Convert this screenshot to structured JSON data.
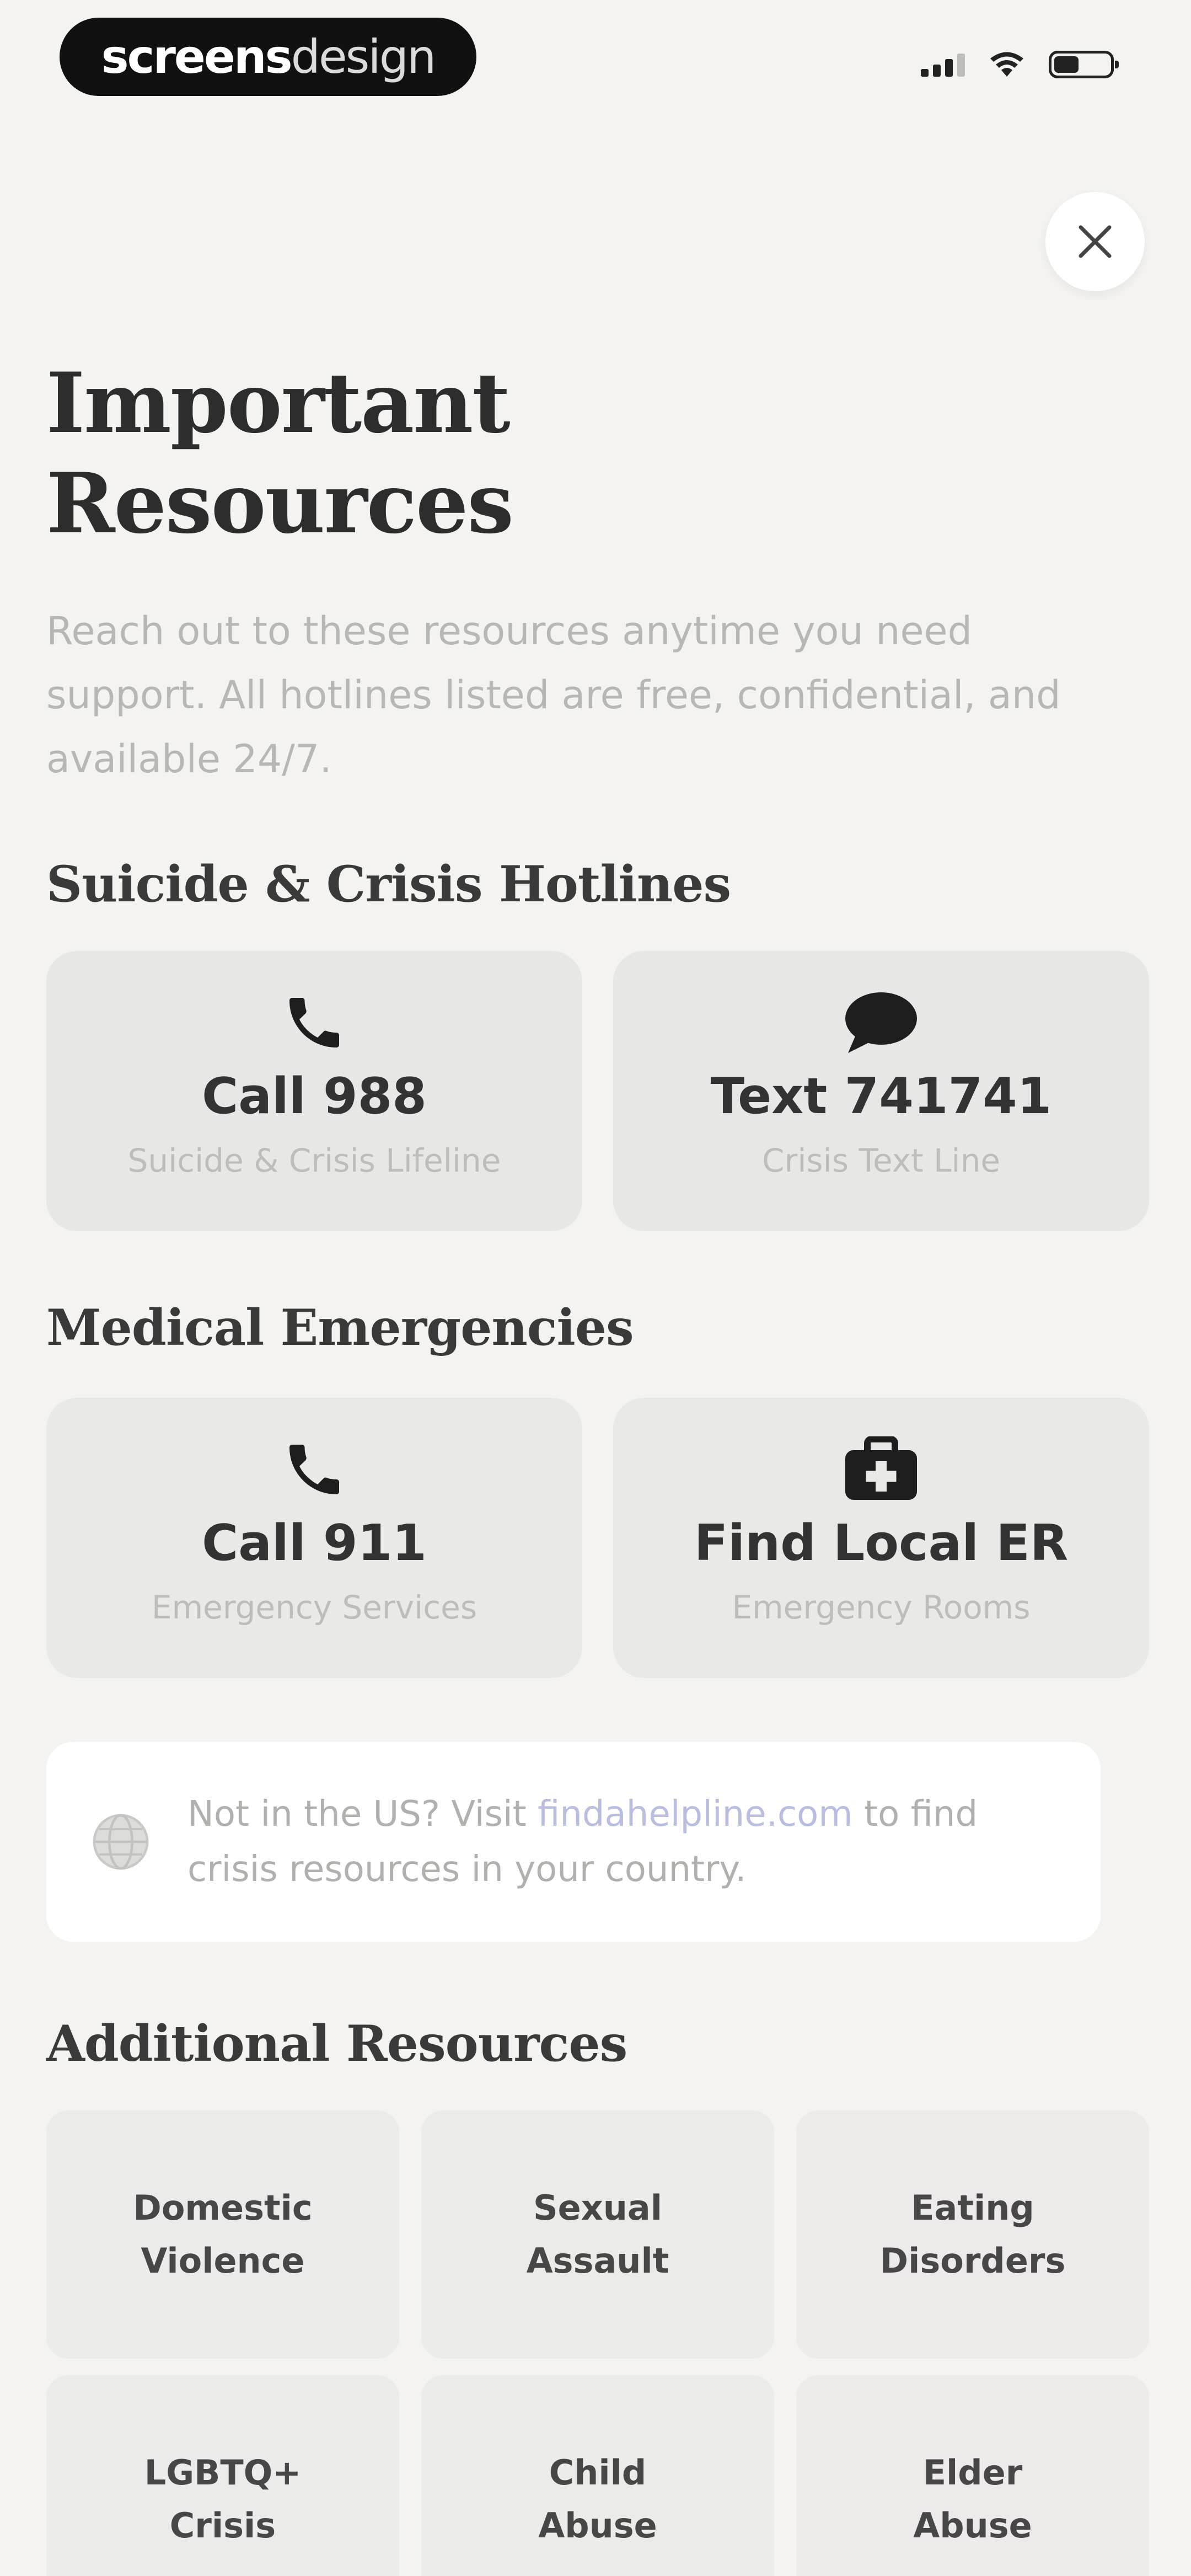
{
  "status_bar": {
    "watermark_bold": "screens",
    "watermark_light": "design"
  },
  "header": {
    "close_label": "Close",
    "title_line1": "Important",
    "title_line2": "Resources",
    "subtitle": "Reach out to these resources anytime you need support. All hotlines listed are free, confidential, and available 24/7."
  },
  "crisis": {
    "heading": "Suicide & Crisis Hotlines",
    "cards": [
      {
        "icon": "phone-icon",
        "title": "Call 988",
        "subtitle": "Suicide & Crisis Lifeline"
      },
      {
        "icon": "chat-bubble-icon",
        "title": "Text 741741",
        "subtitle": "Crisis Text Line"
      }
    ]
  },
  "medical": {
    "heading": "Medical Emergencies",
    "cards": [
      {
        "icon": "phone-icon",
        "title": "Call 911",
        "subtitle": "Emergency Services"
      },
      {
        "icon": "medical-kit-icon",
        "title": "Find Local ER",
        "subtitle": "Emergency Rooms"
      }
    ]
  },
  "info": {
    "icon": "globe-icon",
    "text_before": "Not in the US? Visit ",
    "link": "findahelpline.com",
    "text_after": " to find crisis resources in your country."
  },
  "additional": {
    "heading": "Additional Resources",
    "items": [
      {
        "label_line1": "Domestic",
        "label_line2": "Violence"
      },
      {
        "label_line1": "Sexual",
        "label_line2": "Assault"
      },
      {
        "label_line1": "Eating",
        "label_line2": "Disorders"
      },
      {
        "label_line1": "LGBTQ+",
        "label_line2": "Crisis"
      },
      {
        "label_line1": "Child",
        "label_line2": "Abuse"
      },
      {
        "label_line1": "Elder",
        "label_line2": "Abuse"
      }
    ]
  },
  "colors": {
    "background": "#f4f3f0",
    "card": "#e8e8e6",
    "info_box": "#ffffff",
    "link": "#b9bde0"
  }
}
